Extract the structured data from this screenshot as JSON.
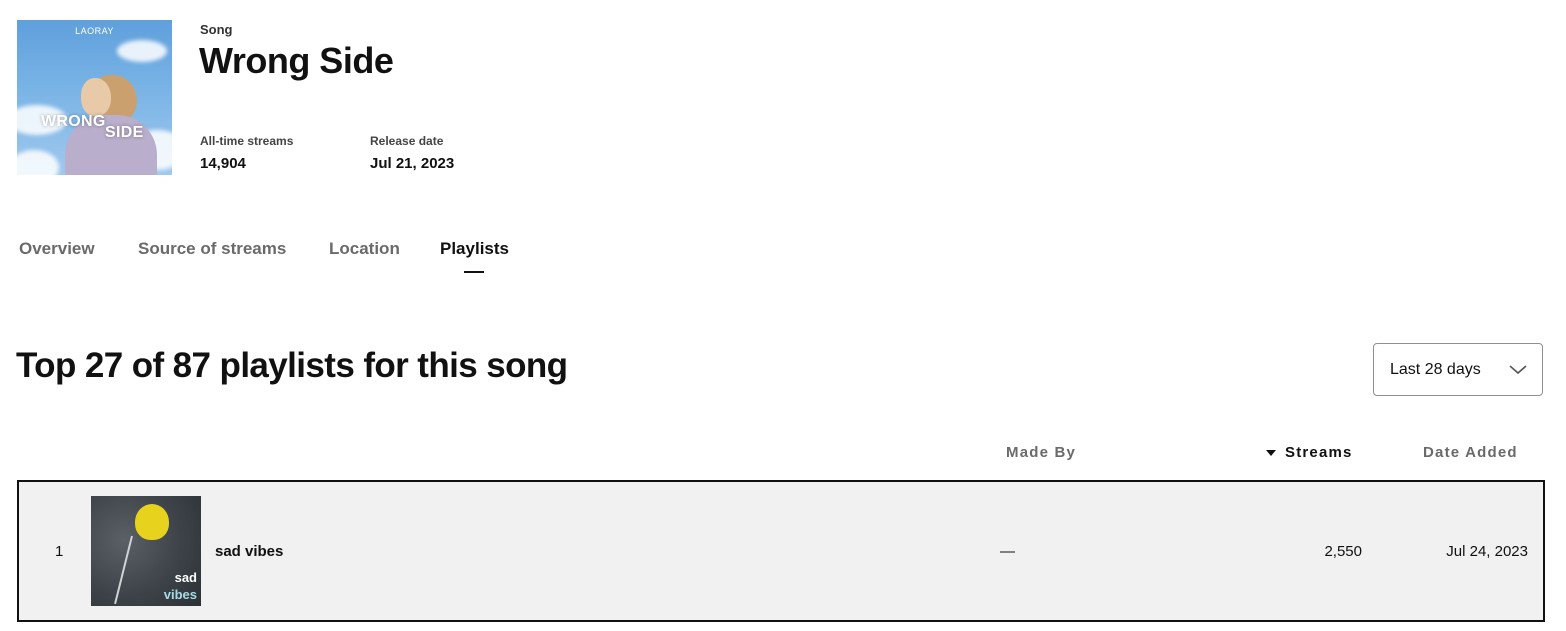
{
  "song": {
    "kind": "Song",
    "title": "Wrong Side",
    "cover": {
      "artist_text": "LAORAY",
      "title_line1": "WRONG",
      "title_line2": "SIDE"
    },
    "stats": [
      {
        "label": "All-time streams",
        "value": "14,904"
      },
      {
        "label": "Release date",
        "value": "Jul 21, 2023"
      }
    ]
  },
  "tabs": [
    {
      "label": "Overview",
      "active": false
    },
    {
      "label": "Source of streams",
      "active": false
    },
    {
      "label": "Location",
      "active": false
    },
    {
      "label": "Playlists",
      "active": true
    }
  ],
  "section": {
    "title": "Top 27 of 87 playlists for this song",
    "range_select": {
      "selected": "Last 28 days",
      "icon": "chevron-down-icon"
    }
  },
  "table": {
    "columns": [
      "Made By",
      "Streams",
      "Date Added"
    ],
    "sorted_column": "Streams",
    "sort_direction": "descending",
    "rows": [
      {
        "rank": "1",
        "name": "sad vibes",
        "cover_text_line1": "sad",
        "cover_text_line2": "vibes",
        "made_by": "—",
        "streams": "2,550",
        "date_added": "Jul 24, 2023"
      }
    ]
  },
  "colors": {
    "row_background": "#f1f1f1",
    "row_border": "#111111",
    "inactive_tab": "#6a6a6a",
    "active_tab": "#111111"
  }
}
